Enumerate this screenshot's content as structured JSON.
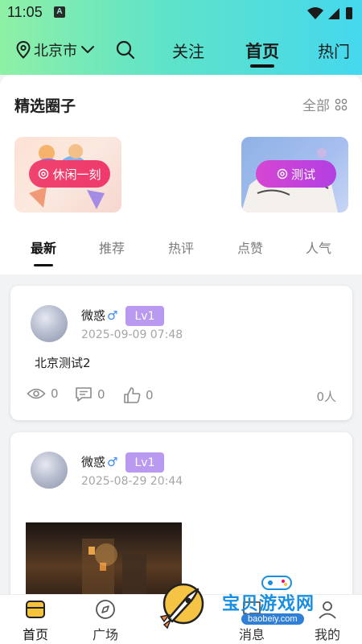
{
  "status_bar": {
    "time": "11:05",
    "badge": "A"
  },
  "nav": {
    "city": "北京市",
    "tabs": [
      {
        "label": "关注"
      },
      {
        "label": "首页"
      },
      {
        "label": "热门"
      }
    ],
    "active_tab": "首页"
  },
  "circles": {
    "title": "精选圈子",
    "all_label": "全部",
    "items": [
      {
        "label": "休闲一刻"
      },
      {
        "label": "测试"
      }
    ]
  },
  "feed_tabs": [
    {
      "label": "最新"
    },
    {
      "label": "推荐"
    },
    {
      "label": "热评"
    },
    {
      "label": "点赞"
    },
    {
      "label": "人气"
    }
  ],
  "posts": [
    {
      "username": "微惑",
      "gender": "♂",
      "level": "Lv1",
      "time": "2025-09-09 07:48",
      "text": "北京测试2",
      "views": "0",
      "comments": "0",
      "likes": "0",
      "people": "0人"
    },
    {
      "username": "微惑",
      "gender": "♂",
      "level": "Lv1",
      "time": "2025-08-29 20:44"
    }
  ],
  "bottom_bar": {
    "items": [
      {
        "label": "首页"
      },
      {
        "label": "广场"
      },
      {
        "label": "消息"
      },
      {
        "label": "我的"
      }
    ]
  },
  "watermark": {
    "title": "宝贝游戏网",
    "url": "baobeiy.com"
  },
  "colors": {
    "header_gradient": [
      "#8ff0a6",
      "#45d8ee"
    ],
    "pill_pink": "#ee3a6c",
    "pill_purple": "#b23fe2",
    "level_badge": "#b99af0",
    "gender_male": "#3d8bf2"
  }
}
